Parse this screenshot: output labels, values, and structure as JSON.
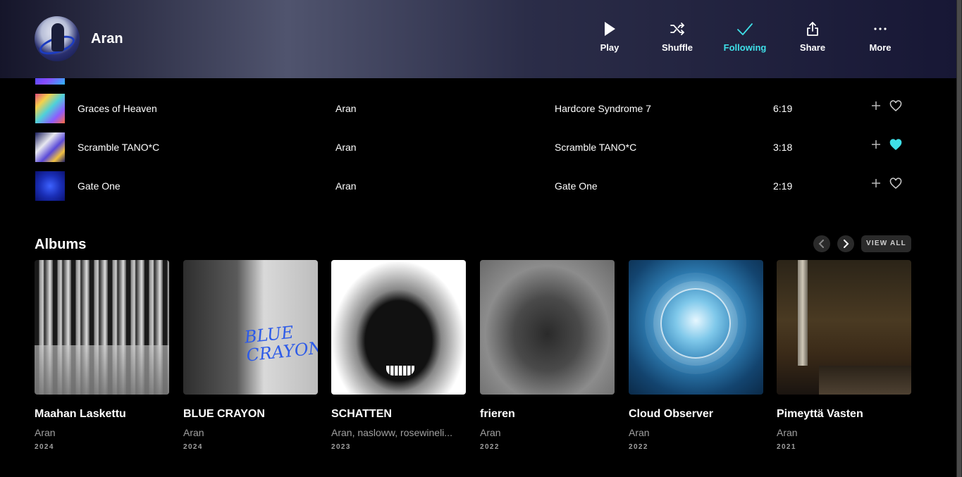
{
  "header": {
    "artist_name": "Aran",
    "actions": [
      {
        "label": "Play",
        "icon": "play-icon",
        "active": false
      },
      {
        "label": "Shuffle",
        "icon": "shuffle-icon",
        "active": false
      },
      {
        "label": "Following",
        "icon": "check-icon",
        "active": true
      },
      {
        "label": "Share",
        "icon": "share-icon",
        "active": false
      },
      {
        "label": "More",
        "icon": "more-icon",
        "active": false
      }
    ],
    "active_color": "#3fe0e8"
  },
  "tracks": [
    {
      "title": "Graces of Heaven",
      "artist": "Aran",
      "album": "Hardcore Syndrome 7",
      "duration": "6:19",
      "favorited": false
    },
    {
      "title": "Scramble TANO*C",
      "artist": "Aran",
      "album": "Scramble TANO*C",
      "duration": "3:18",
      "favorited": true
    },
    {
      "title": "Gate One",
      "artist": "Aran",
      "album": "Gate One",
      "duration": "2:19",
      "favorited": false
    }
  ],
  "albums_section": {
    "title": "Albums",
    "view_all_label": "VIEW ALL",
    "items": [
      {
        "title": "Maahan Laskettu",
        "artist": "Aran",
        "year": "2024"
      },
      {
        "title": "BLUE CRAYON",
        "artist": "Aran",
        "year": "2024",
        "cover_text": "BLUE CRAYON"
      },
      {
        "title": "SCHATTEN",
        "artist": "Aran, nasloww, rosewineli...",
        "year": "2023"
      },
      {
        "title": "frieren",
        "artist": "Aran",
        "year": "2022"
      },
      {
        "title": "Cloud Observer",
        "artist": "Aran",
        "year": "2022"
      },
      {
        "title": "Pimeyttä Vasten",
        "artist": "Aran",
        "year": "2021"
      }
    ]
  }
}
